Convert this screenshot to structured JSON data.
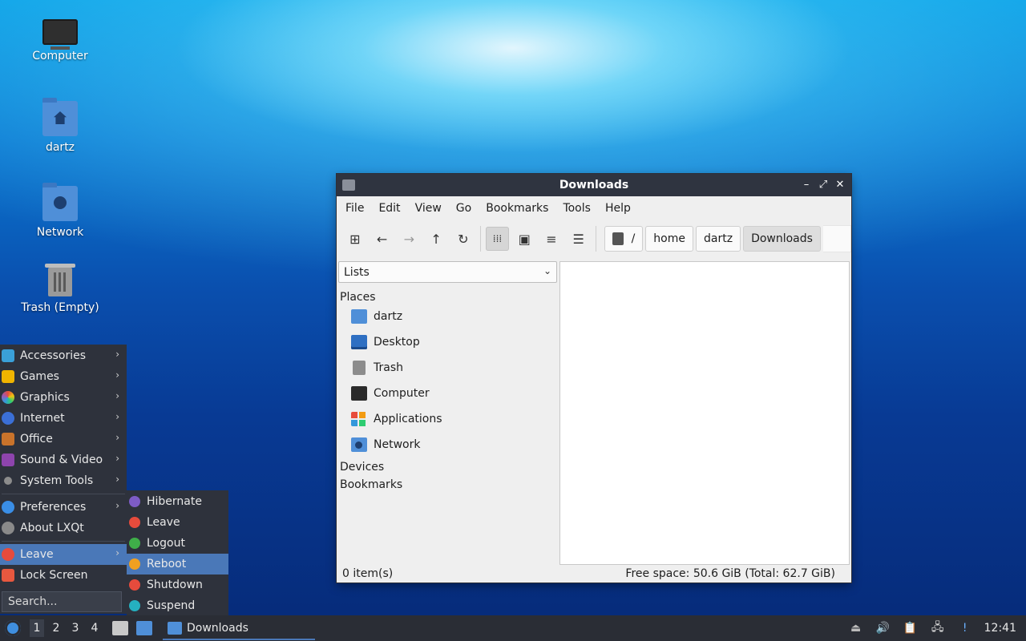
{
  "desktop": {
    "icons": [
      {
        "label": "Computer"
      },
      {
        "label": "dartz"
      },
      {
        "label": "Network"
      },
      {
        "label": "Trash (Empty)"
      }
    ]
  },
  "window": {
    "title": "Downloads",
    "controls": {
      "minimize": "–",
      "maximize": "⤢",
      "close": "✕"
    },
    "menu": [
      "File",
      "Edit",
      "View",
      "Go",
      "Bookmarks",
      "Tools",
      "Help"
    ],
    "breadcrumbs": [
      "/",
      "home",
      "dartz",
      "Downloads"
    ],
    "sidebar": {
      "view_select": "Lists",
      "places_header": "Places",
      "places": [
        "dartz",
        "Desktop",
        "Trash",
        "Computer",
        "Applications",
        "Network"
      ],
      "devices_header": "Devices",
      "bookmarks_header": "Bookmarks"
    },
    "status": {
      "items": "0 item(s)",
      "free_space": "Free space: 50.6 GiB (Total: 62.7 GiB)"
    }
  },
  "start_menu": {
    "categories": [
      "Accessories",
      "Games",
      "Graphics",
      "Internet",
      "Office",
      "Sound & Video",
      "System Tools"
    ],
    "settings": [
      "Preferences",
      "About LXQt"
    ],
    "session": [
      "Leave",
      "Lock Screen"
    ],
    "search_placeholder": "Search...",
    "leave_submenu": [
      "Hibernate",
      "Leave",
      "Logout",
      "Reboot",
      "Shutdown",
      "Suspend"
    ],
    "highlighted_submenu_item": "Reboot"
  },
  "taskbar": {
    "desktops": [
      "1",
      "2",
      "3",
      "4"
    ],
    "current_desktop": "1",
    "task_label": "Downloads",
    "clock": "12:41"
  },
  "colors": {
    "accent": "#4a78b8",
    "panel": "#2e323c",
    "folder": "#4f8fd8"
  }
}
